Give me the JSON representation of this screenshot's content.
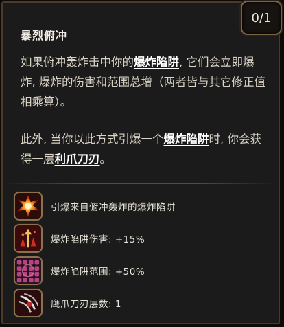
{
  "counter": {
    "value": "0/1"
  },
  "skill": {
    "title": "暴烈俯冲",
    "paragraph1": {
      "before": "如果俯冲轰炸击中你的",
      "keyword": "爆炸陷阱",
      "after": ", 它们会立即爆炸, 爆炸的伤害和范围总增（两者皆与其它修正值相乘算）。"
    },
    "paragraph2": {
      "before": "此外, 当你以此方式引爆一个",
      "keyword1": "爆炸陷阱",
      "middle": "时, 你会获得一层",
      "keyword2": "利爪刀刃",
      "after": "。"
    }
  },
  "effects": [
    {
      "icon": "explosion-icon",
      "text": "引爆来自俯冲轰炸的爆炸陷阱"
    },
    {
      "icon": "trap-damage-icon",
      "text": "爆炸陷阱伤害: +15%"
    },
    {
      "icon": "trap-area-icon",
      "text": "爆炸陷阱范围: +50%"
    },
    {
      "icon": "claw-blade-icon",
      "text": "鹰爪刀刃层数: 1"
    }
  ],
  "colors": {
    "background": "#1b1b1b",
    "border": "#4a3a27",
    "keyword": "#ffffff",
    "body_text": "#d9d3c6"
  }
}
